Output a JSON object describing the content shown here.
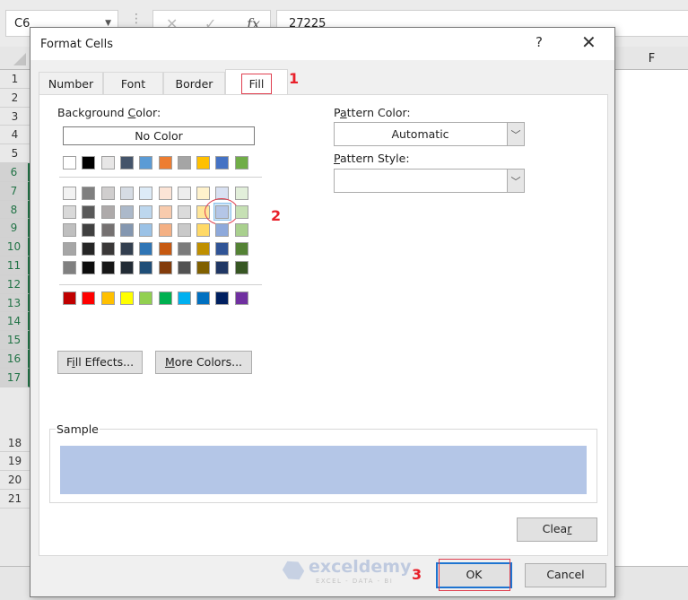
{
  "excel": {
    "name_box": "C6",
    "formula_bar_value": "27225",
    "fx_label": "fx",
    "column_visible": "F",
    "rows": [
      {
        "label": "1",
        "selected": false
      },
      {
        "label": "2",
        "selected": false
      },
      {
        "label": "3",
        "selected": false
      },
      {
        "label": "4",
        "selected": false
      },
      {
        "label": "5",
        "selected": false
      },
      {
        "label": "6",
        "selected": true
      },
      {
        "label": "7",
        "selected": true
      },
      {
        "label": "8",
        "selected": true
      },
      {
        "label": "9",
        "selected": true
      },
      {
        "label": "10",
        "selected": true
      },
      {
        "label": "11",
        "selected": true
      },
      {
        "label": "12",
        "selected": true
      },
      {
        "label": "13",
        "selected": true
      },
      {
        "label": "14",
        "selected": true
      },
      {
        "label": "15",
        "selected": true
      },
      {
        "label": "16",
        "selected": true
      },
      {
        "label": "17",
        "selected": true
      },
      {
        "label": "",
        "selected": false,
        "gap": true
      },
      {
        "label": "18",
        "selected": false
      },
      {
        "label": "19",
        "selected": false
      },
      {
        "label": "20",
        "selected": false
      },
      {
        "label": "21",
        "selected": false
      }
    ]
  },
  "dialog": {
    "title": "Format Cells",
    "help_label": "?",
    "close_label": "✕",
    "tabs": [
      {
        "label": "Number",
        "active": false
      },
      {
        "label": "Font",
        "active": false
      },
      {
        "label": "Border",
        "active": false
      },
      {
        "label": "Fill",
        "active": true
      }
    ],
    "background_color_label": "Background Color:",
    "no_color_label": "No Color",
    "theme_top_row": [
      "#ffffff",
      "#000000",
      "#e7e6e6",
      "#44546a",
      "#5b9bd5",
      "#ed7d31",
      "#a5a5a5",
      "#ffc000",
      "#4472c4",
      "#70ad47"
    ],
    "theme_shades": [
      [
        "#f2f2f2",
        "#7f7f7f",
        "#d0cece",
        "#d6dce4",
        "#ddebf7",
        "#fce4d6",
        "#ededed",
        "#fff2cc",
        "#d9e1f2",
        "#e2efda"
      ],
      [
        "#d9d9d9",
        "#595959",
        "#aeaaaa",
        "#acb9ca",
        "#bdd7ee",
        "#f8cbad",
        "#dbdbdb",
        "#ffe699",
        "#b4c6e7",
        "#c6e0b4"
      ],
      [
        "#bfbfbf",
        "#404040",
        "#757171",
        "#8497b0",
        "#9bc2e6",
        "#f4b084",
        "#c9c9c9",
        "#ffd966",
        "#8ea9db",
        "#a9d08e"
      ],
      [
        "#a6a6a6",
        "#262626",
        "#3a3838",
        "#333f4f",
        "#2f75b5",
        "#c65911",
        "#7b7b7b",
        "#bf8f00",
        "#305496",
        "#548235"
      ],
      [
        "#808080",
        "#0d0d0d",
        "#161616",
        "#222b35",
        "#1f4e78",
        "#833c0b",
        "#525252",
        "#806000",
        "#203764",
        "#375623"
      ]
    ],
    "standard_colors": [
      "#c00000",
      "#ff0000",
      "#ffc000",
      "#ffff00",
      "#92d050",
      "#00b050",
      "#00b0f0",
      "#0070c0",
      "#002060",
      "#7030a0"
    ],
    "selected_color": "#b4c6e7",
    "fill_effects_label": "Fill Effects...",
    "more_colors_label": "More Colors...",
    "pattern_color_label": "Pattern Color:",
    "pattern_color_value": "Automatic",
    "pattern_style_label": "Pattern Style:",
    "pattern_style_value": "",
    "sample_label": "Sample",
    "clear_label": "Clear",
    "ok_label": "OK",
    "cancel_label": "Cancel"
  },
  "annotations": {
    "step1": "1",
    "step2": "2",
    "step3": "3"
  },
  "watermark": {
    "brand": "exceldemy",
    "tagline": "EXCEL - DATA - BI"
  }
}
